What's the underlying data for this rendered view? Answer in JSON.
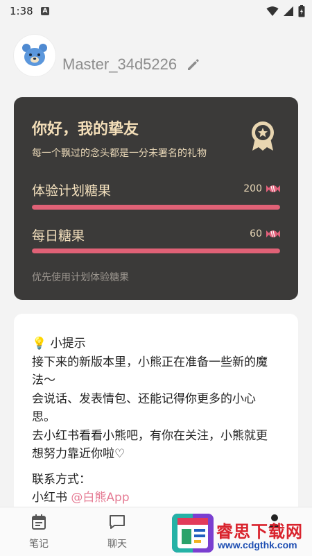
{
  "status_bar": {
    "time": "1:38",
    "notification_letter": "A"
  },
  "profile": {
    "username": "Master_34d5226"
  },
  "greeting_card": {
    "title": "你好，我的挚友",
    "subtitle": "每一个飘过的念头都是一分未署名的礼物",
    "rows": [
      {
        "label": "体验计划糖果",
        "value": "200",
        "progress": 1.0
      },
      {
        "label": "每日糖果",
        "value": "60",
        "progress": 1.0
      }
    ],
    "footer": "优先使用计划体验糖果"
  },
  "tips": {
    "lines": [
      "💡 小提示",
      "接下来的新版本里，小熊正在准备一些新的魔",
      "法～",
      "会说话、发表情包、还能记得你更多的小心",
      "思。",
      "去小红书看看小熊吧，有你在关注，小熊就更",
      "想努力靠近你啦♡",
      "",
      "联系方式："
    ],
    "contact_platform": "小红书",
    "contact_handle": "@白熊App"
  },
  "bottom_nav": {
    "items": [
      {
        "label": "笔记",
        "icon": "calendar-notes-icon"
      },
      {
        "label": "聊天",
        "icon": "chat-bubble-icon"
      }
    ]
  },
  "watermark": {
    "title": "睿思下载网",
    "url": "www.cdgthk.com"
  }
}
